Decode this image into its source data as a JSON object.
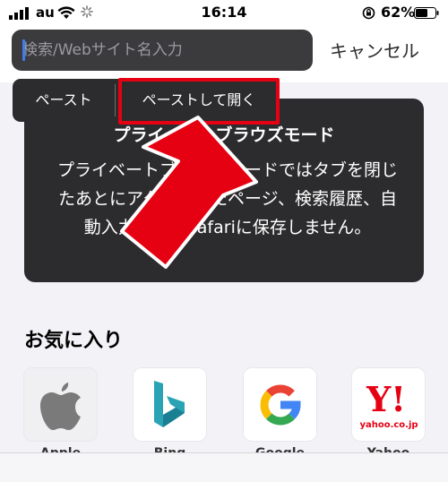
{
  "status_bar": {
    "carrier": "au",
    "time": "16:14",
    "battery": "62%",
    "battery_level": 0.62
  },
  "address_bar": {
    "placeholder": "検索/Webサイト名入力",
    "value": "",
    "cancel_label": "キャンセル"
  },
  "edit_menu": {
    "paste_label": "ペースト",
    "paste_and_go_label": "ペーストして開く"
  },
  "private_mode": {
    "title": "プライベートブラウズモード",
    "body": "プライベートブラウズモードではタブを閉じたあとにアクセスしたページ、検索履歴、自動入力情報をSafariに保存しません。"
  },
  "favorites": {
    "title": "お気に入り",
    "items": [
      {
        "label": "Apple",
        "icon": "apple-icon"
      },
      {
        "label": "Bing",
        "icon": "bing-icon"
      },
      {
        "label": "Google",
        "icon": "google-icon"
      },
      {
        "label": "Yahoo",
        "icon": "yahoo-icon",
        "logo_text": "yahoo.co.jp"
      }
    ]
  },
  "colors": {
    "accent_red": "#e50012",
    "card": "#2c2c2e",
    "caret": "#3f7cf0"
  }
}
